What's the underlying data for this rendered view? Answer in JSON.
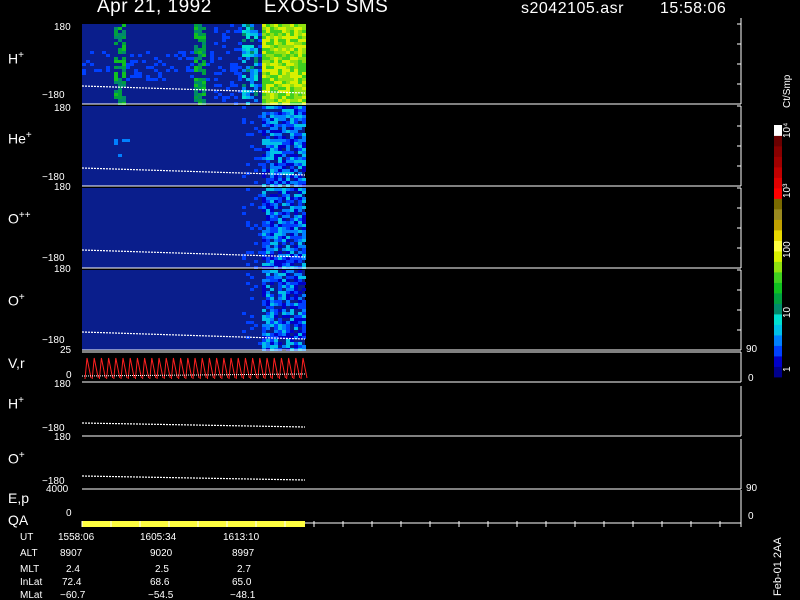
{
  "header": {
    "date": "Apr 21, 1992",
    "instrument": "EXOS-D SMS",
    "file": "s2042105.asr",
    "time": "15:58:06"
  },
  "colorbar": {
    "unit_label": "Ct/Smp",
    "ticks": [
      {
        "text": "1",
        "value": 1
      },
      {
        "text": "10",
        "value": 10
      },
      {
        "text": "100",
        "value": 100
      },
      {
        "text": "10³",
        "value": 1000
      },
      {
        "text": "10⁴",
        "value": 10000
      }
    ],
    "colors": [
      "#00008b",
      "#0000c8",
      "#0040ff",
      "#0080ff",
      "#00c0e8",
      "#00e0d0",
      "#008a6a",
      "#00a040",
      "#10c020",
      "#40d020",
      "#90e010",
      "#d8f000",
      "#ffff40",
      "#e8d800",
      "#c0a000",
      "#9a8a20",
      "#7a6a00",
      "#ff0000",
      "#e00000",
      "#c00000",
      "#a00000",
      "#880000",
      "#6a0000",
      "#ffffff"
    ]
  },
  "panels": [
    {
      "label": "H",
      "sup": "+",
      "ytop": "180",
      "ybot": "−180",
      "intensity": "high"
    },
    {
      "label": "He",
      "sup": "+",
      "ytop": "180",
      "ybot": "−180",
      "intensity": "low"
    },
    {
      "label": "O",
      "sup": "++",
      "ytop": "180",
      "ybot": "−180",
      "intensity": "low"
    },
    {
      "label": "O",
      "sup": "+",
      "ytop": "180",
      "ybot": "−180",
      "intensity": "low"
    }
  ],
  "vr_panel": {
    "label": "V,r",
    "ytop": "25",
    "ybot": "0",
    "right_top": "90",
    "right_bot": "0"
  },
  "line_panels": [
    {
      "label": "H",
      "sup": "+",
      "ytop": "180",
      "ybot": "−180"
    },
    {
      "label": "O",
      "sup": "+",
      "ytop": "180",
      "ybot": "−180"
    }
  ],
  "ep_panel": {
    "label": "E,p",
    "ytop": "4000",
    "ybot": "0",
    "right_top": "90",
    "right_bot": "0"
  },
  "qa_label": "QA",
  "ephemeris": {
    "rows": [
      "UT",
      "ALT",
      "MLT",
      "InLat",
      "MLat"
    ],
    "columns": [
      [
        "1558:06",
        "8907",
        "2.4",
        "72.4",
        "−60.7"
      ],
      [
        "1605:34",
        "9020",
        "2.5",
        "68.6",
        "−54.5"
      ],
      [
        "1613:10",
        "8997",
        "2.7",
        "65.0",
        "−48.1"
      ]
    ]
  },
  "footer_version": "Feb-01 2AA",
  "chart_data": {
    "type": "heatmap",
    "title": "Apr 21, 1992   EXOS-D SMS",
    "x_ticks": [
      "1558:06",
      "1605:34",
      "1613:10"
    ],
    "colorbar_label": "Ct/Smp",
    "colorbar_range": [
      1,
      10000
    ],
    "colorbar_scale": "log",
    "series": [
      {
        "name": "H+",
        "ylim": [
          -180,
          180
        ]
      },
      {
        "name": "He+",
        "ylim": [
          -180,
          180
        ]
      },
      {
        "name": "O++",
        "ylim": [
          -180,
          180
        ]
      },
      {
        "name": "O+",
        "ylim": [
          -180,
          180
        ]
      },
      {
        "name": "V,r",
        "ylim": [
          0,
          25
        ],
        "y2lim": [
          0,
          90
        ]
      },
      {
        "name": "H+",
        "ylim": [
          -180,
          180
        ]
      },
      {
        "name": "O+",
        "ylim": [
          -180,
          180
        ]
      },
      {
        "name": "E,p",
        "ylim": [
          0,
          4000
        ],
        "y2lim": [
          0,
          90
        ]
      }
    ]
  }
}
